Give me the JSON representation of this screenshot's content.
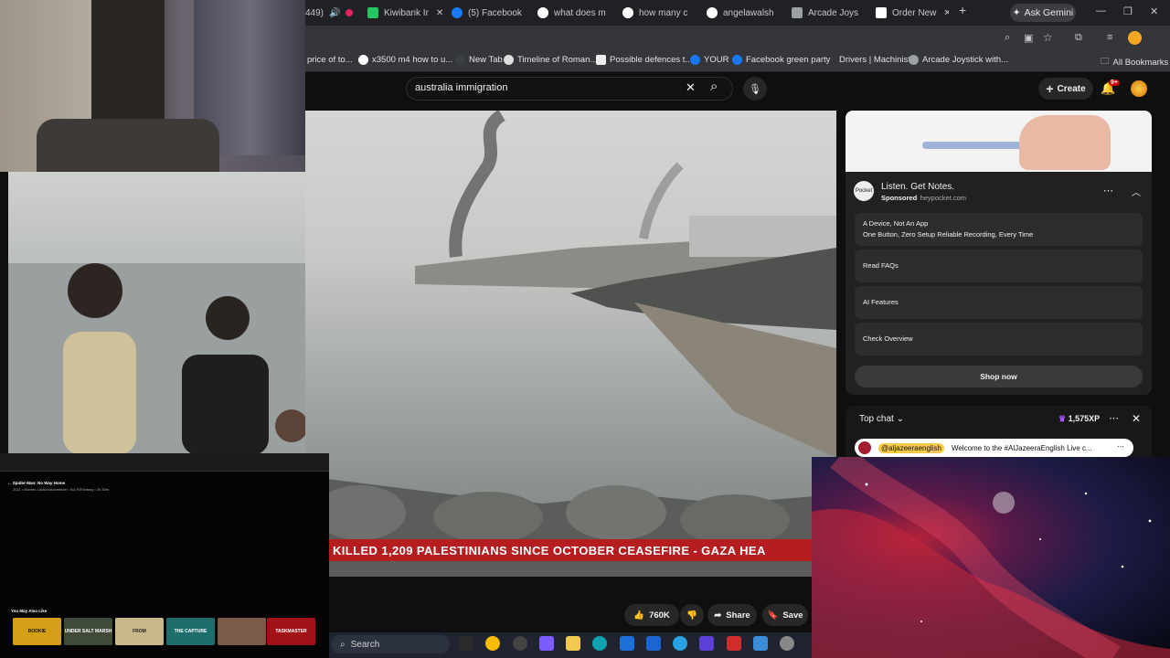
{
  "tabs": [
    {
      "label": "449)",
      "favicon": "#e0245e"
    },
    {
      "label": "Kiwibank Ir",
      "favicon": "#22c55e"
    },
    {
      "label": "(5) Facebook",
      "favicon": "#1877f2"
    },
    {
      "label": "what does m",
      "favicon": "#ffffff"
    },
    {
      "label": "how many c",
      "favicon": "#ffffff"
    },
    {
      "label": "angelawalsh",
      "favicon": "#ffffff"
    },
    {
      "label": "Arcade Joys",
      "favicon": "#9aa0a6"
    },
    {
      "label": "Order New",
      "favicon": "#ffffff"
    }
  ],
  "gemini_label": "Ask Gemini",
  "bookmarks": [
    {
      "label": "price of to..."
    },
    {
      "label": "x3500 m4 how to u..."
    },
    {
      "label": "New Tab"
    },
    {
      "label": "Timeline of Roman..."
    },
    {
      "label": "Possible defences t..."
    },
    {
      "label": "YOUR"
    },
    {
      "label": "Facebook green party"
    },
    {
      "label": "Drivers | Machinist"
    },
    {
      "label": "Arcade Joystick with..."
    },
    {
      "label": "All Bookmarks"
    }
  ],
  "youtube": {
    "search_value": "australia immigration",
    "create_label": "Create",
    "notif_count": "9+",
    "ticker_text": "KILLED 1,209 PALESTINIANS SINCE OCTOBER CEASEFIRE   -   GAZA HEA",
    "like_count": "760K",
    "share_label": "Share",
    "save_label": "Save"
  },
  "ad": {
    "title": "Listen. Get Notes.",
    "sponsored": "Sponsored",
    "domain": "heypocket.com",
    "logo_text": "Pocket",
    "row1_title": "A Device, Not An App",
    "row1_sub": "One Button, Zero Setup Reliable Recording, Every Time",
    "row2": "Read FAQs",
    "row3": "AI Features",
    "row4": "Check Overview",
    "shop": "Shop now"
  },
  "chat": {
    "title": "Top chat",
    "xp": "1,575XP",
    "msg_user": "@aljazeeraenglish",
    "msg_text": "Welcome to the #AlJazeeraEnglish Live c..."
  },
  "netflix": {
    "title": "Spider-Man: No Way Home",
    "meta": "2021 • Movies • Action/Adventure • Sci-Fi/Fantasy • 2h 30m",
    "you_may_also_like": "You May Also Like",
    "thumbs": [
      "ROOKIE",
      "UNDER SALT MARSH",
      "FROM",
      "THE CAPTURE",
      "",
      "TASKMASTER"
    ]
  },
  "taskbar": {
    "search_placeholder": "Search"
  }
}
